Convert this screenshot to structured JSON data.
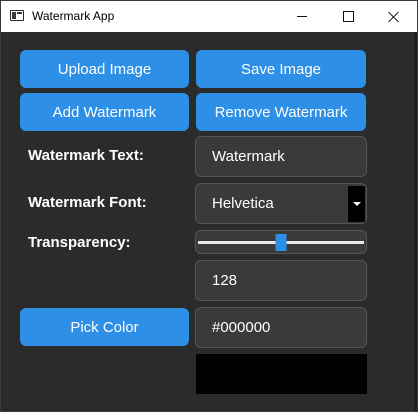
{
  "window": {
    "title": "Watermark App"
  },
  "buttons": {
    "upload": "Upload Image",
    "save": "Save Image",
    "add_watermark": "Add Watermark",
    "remove_watermark": "Remove Watermark",
    "pick_color": "Pick Color"
  },
  "form": {
    "watermark_text_label": "Watermark Text:",
    "watermark_text_value": "Watermark",
    "watermark_font_label": "Watermark Font:",
    "watermark_font_value": "Helvetica",
    "transparency_label": "Transparency:",
    "transparency_value": "128",
    "transparency_max": 255,
    "color_value": "#000000"
  },
  "colors": {
    "accent": "#2d8fe6",
    "background": "#2b2b2b",
    "field_background": "#3a3a3a",
    "swatch": "#000000"
  },
  "icons": {
    "app": "app-window-icon",
    "minimize": "minimize-icon",
    "maximize": "maximize-icon",
    "close": "close-icon",
    "dropdown": "chevron-down-icon"
  }
}
